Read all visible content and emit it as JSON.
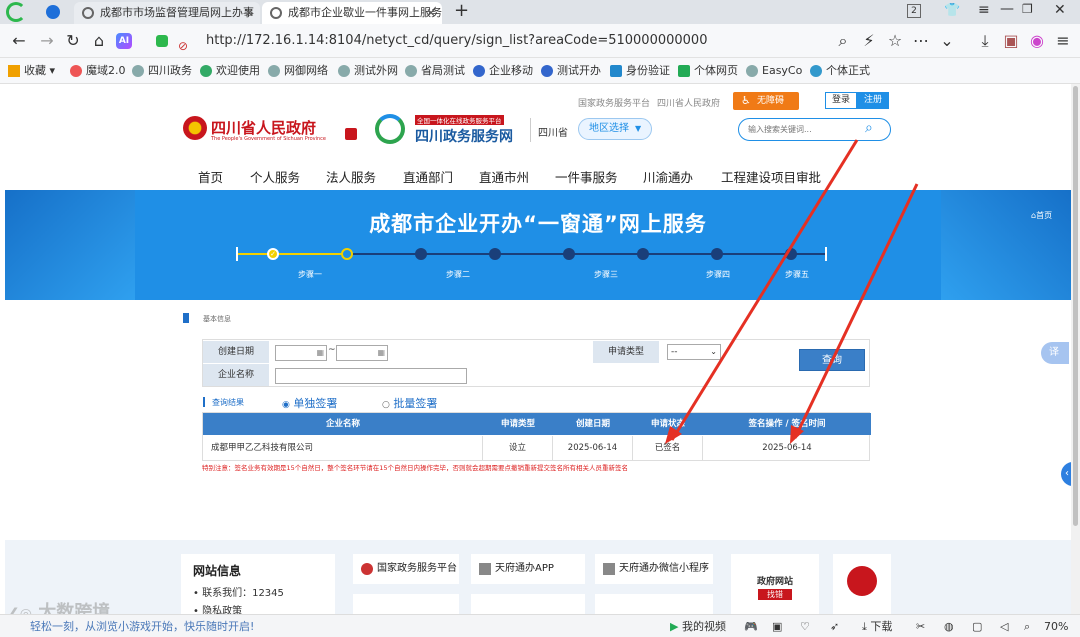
{
  "browser": {
    "tabs": [
      {
        "title": "成都市市场监督管理局网上办事",
        "active": false
      },
      {
        "title": "成都市企业歇业一件事网上服务",
        "active": true
      }
    ],
    "new_tab": "+",
    "tab_count": "2",
    "url": "http://172.16.1.14:8104/netyct_cd/query/sign_list?areaCode=510000000000",
    "bookmarks": [
      "收藏",
      "魔域2.0",
      "四川政务",
      "欢迎使用",
      "网御网络",
      "测试外网",
      "省局测试",
      "企业移动",
      "测试开办",
      "身份验证",
      "个体网页",
      "EasyCo",
      "个体正式"
    ]
  },
  "site": {
    "top_links": [
      "国家政务服务平台",
      "四川省人民政府"
    ],
    "accessibility_btn": "无障碍",
    "login": "登录",
    "register": "注册",
    "logo_gov": "四川省人民政府",
    "logo_gov_en": "The People's Government of Sichuan Province",
    "logo_portal_top": "全国一体化在线政务服务平台",
    "logo_portal": "四川政务服务网",
    "province": "四川省",
    "region_select": "地区选择",
    "search_placeholder": "输入搜索关键词...",
    "nav": [
      "首页",
      "个人服务",
      "法人服务",
      "直通部门",
      "直通市州",
      "一件事服务",
      "川渝通办",
      "工程建设项目审批"
    ]
  },
  "banner": {
    "title": "成都市企业开办“一窗通”网上服务",
    "home": "首页",
    "steps": [
      "步骤一",
      "步骤二",
      "步骤三",
      "步骤四",
      "步骤五"
    ]
  },
  "section": {
    "title": "基本信息"
  },
  "form": {
    "create_date_label": "创建日期",
    "range_sep": "~",
    "apply_type_label": "申请类型",
    "apply_type_value": "--",
    "company_label": "企业名称",
    "query_btn": "查询"
  },
  "results": {
    "label": "查询结果",
    "radio_single": "单独签署",
    "radio_batch": "批量签署",
    "columns": [
      "企业名称",
      "申请类型",
      "创建日期",
      "申请状态",
      "签名操作 / 签名时间"
    ],
    "rows": [
      [
        "成都甲甲乙乙科技有限公司",
        "设立",
        "2025-06-14",
        "已签名",
        "2025-06-14"
      ]
    ],
    "notice": "特别注意：签名业务有效期是15个自然日，整个签名环节请在15个自然日内操作完毕，否则就会超期需要点撤销重新提交签名所有相关人员重新签名"
  },
  "footer": {
    "title": "网站信息",
    "contact": "联系我们：12345",
    "privacy": "隐私政策",
    "links": [
      "国家政务服务平台",
      "天府通办APP",
      "天府通办微信小程序"
    ],
    "gov_site": "政府网站",
    "gov_site_sub": "找错"
  },
  "statusbar": {
    "left_text": "轻松一刻，从浏览小游戏开始，快乐随时开启!",
    "video": "我的视频",
    "download": "下载",
    "zoom": "70%"
  },
  "watermark": "大数跨境"
}
